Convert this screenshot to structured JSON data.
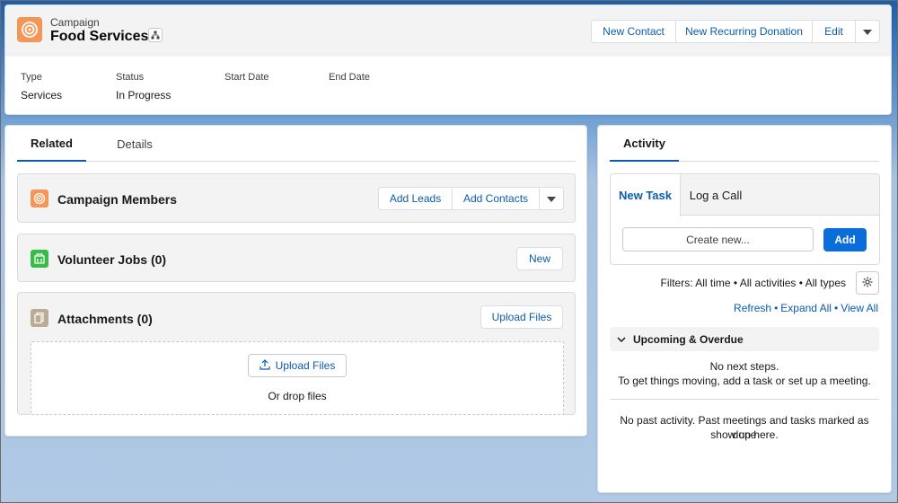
{
  "header": {
    "record_type": "Campaign",
    "record_name": "Food Services",
    "buttons": {
      "new_contact": "New Contact",
      "new_recurring_donation": "New Recurring Donation",
      "edit": "Edit"
    },
    "fields": [
      {
        "label": "Type",
        "value": "Services"
      },
      {
        "label": "Status",
        "value": "In Progress"
      },
      {
        "label": "Start Date",
        "value": ""
      },
      {
        "label": "End Date",
        "value": ""
      }
    ]
  },
  "main": {
    "tabs": [
      {
        "label": "Related"
      },
      {
        "label": "Details"
      }
    ],
    "related": {
      "campaign_members": {
        "title": "Campaign Members",
        "add_leads": "Add Leads",
        "add_contacts": "Add Contacts"
      },
      "volunteer_jobs": {
        "title": "Volunteer Jobs (0)",
        "new_label": "New"
      },
      "attachments": {
        "title": "Attachments (0)",
        "upload_files": "Upload Files",
        "drop_upload": "Upload Files",
        "drop_text": "Or drop files"
      }
    }
  },
  "activity": {
    "tab": "Activity",
    "composer_tabs": {
      "new_task": "New Task",
      "log_call": "Log a Call"
    },
    "create_placeholder": "Create new...",
    "add_label": "Add",
    "filters": "Filters: All time • All activities • All types",
    "links": {
      "refresh": "Refresh",
      "expand_all": "Expand All",
      "view_all": "View All"
    },
    "upcoming_label": "Upcoming & Overdue",
    "no_next_steps_1": "No next steps.",
    "no_next_steps_2": "To get things moving, add a task or set up a meeting.",
    "no_past_1": "No past activity. Past meetings and tasks marked as done",
    "no_past_2": "show up here."
  },
  "colors": {
    "brand": "#0b5cab",
    "campaign_icon": "#f49756",
    "volunteer_icon": "#3bba4c",
    "attachment_icon": "#baac93",
    "primary_button": "#0b6dd9"
  }
}
